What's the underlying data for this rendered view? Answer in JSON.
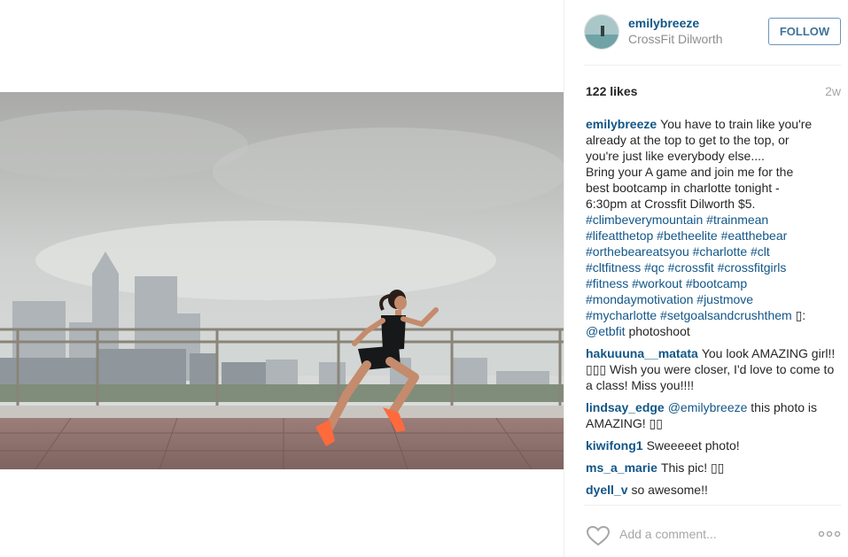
{
  "post": {
    "username": "emilybreeze",
    "location": "CrossFit Dilworth",
    "follow_label": "FOLLOW",
    "likes": "122 likes",
    "time_ago": "2w"
  },
  "caption": {
    "author": "emilybreeze",
    "lines": [
      "You have to train like you're",
      "already at the top to get to the top, or",
      "you're just like everybody else....",
      "Bring your A game and join me for the",
      "best bootcamp in charlotte tonight -",
      "6:30pm at Crossfit Dilworth $5."
    ],
    "tag_lines": [
      "#climbeverymountain #trainmean",
      "#lifeatthetop #betheelite #eatthebear",
      "#orthebeareatsyou #charlotte #clt",
      "#cltfitness #qc #crossfit #crossfitgirls",
      "#fitness #workout #bootcamp",
      "#mondaymotivation #justmove"
    ],
    "last_line_tag": "#mycharlotte #setgoalsandcrushthem",
    "last_line_rest": " ▯:",
    "mention": "@etbfit",
    "mention_rest": " photoshoot"
  },
  "comments": [
    {
      "author": "hakuuuna__matata",
      "text": "You look AMAZING girl!! ▯▯▯ Wish you were closer, I'd love to come to a class! Miss you!!!!"
    },
    {
      "author": "lindsay_edge",
      "mention": "@emilybreeze",
      "text": " this photo is AMAZING! ▯▯"
    },
    {
      "author": "kiwifong1",
      "text": "Sweeeeet photo!"
    },
    {
      "author": "ms_a_marie",
      "text": "This pic! ▯▯"
    },
    {
      "author": "dyell_v",
      "text": "so awesome!!"
    }
  ],
  "add_comment": {
    "placeholder": "Add a comment..."
  },
  "icons": {
    "like": "heart-icon",
    "more": "more-options-icon"
  },
  "colors": {
    "link": "#125688",
    "follow": "#3f729b",
    "muted": "#a5a7aa",
    "shoe": "#ff6a3d"
  }
}
